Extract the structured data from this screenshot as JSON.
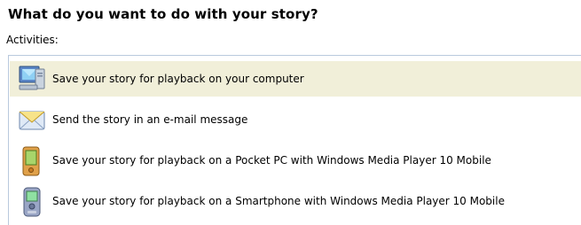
{
  "dialog": {
    "heading": "What do you want to do with your story?",
    "activities_label": "Activities:"
  },
  "activities": [
    {
      "label": "Save your story for playback on your computer",
      "icon": "computer-icon",
      "selected": true
    },
    {
      "label": "Send the story in an e-mail message",
      "icon": "email-envelope-icon",
      "selected": false
    },
    {
      "label": "Save your story for playback on a Pocket PC with Windows Media Player 10 Mobile",
      "icon": "pocket-pc-icon",
      "selected": false
    },
    {
      "label": "Save your story for playback on a Smartphone with Windows Media Player 10 Mobile",
      "icon": "smartphone-icon",
      "selected": false
    }
  ],
  "colors": {
    "selection_background": "#f1efd9",
    "list_border": "#b9c9dd"
  }
}
